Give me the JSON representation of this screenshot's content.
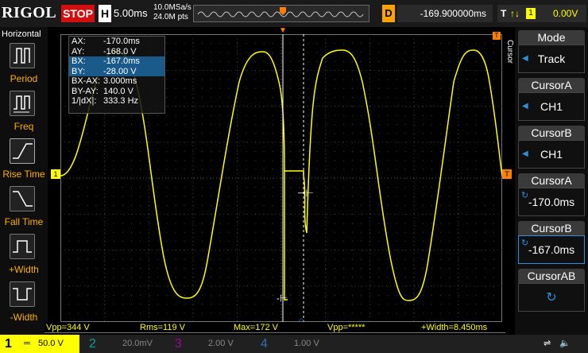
{
  "topbar": {
    "logo": "RIGOL",
    "run_state": "STOP",
    "h_label": "H",
    "timebase": "5.00ms",
    "sample_rate": "10.0MSa/s",
    "mem_depth": "24.0M pts",
    "delay_label": "D",
    "delay_value": "-169.900000ms",
    "trigger_label": "T",
    "trigger_source": "1",
    "trigger_level": "0.00V"
  },
  "left_panel": {
    "title": "Horizontal",
    "items": [
      {
        "label": "Period",
        "icon": "period-icon"
      },
      {
        "label": "Freq",
        "icon": "freq-icon"
      },
      {
        "label": "Rise Time",
        "icon": "rise-time-icon"
      },
      {
        "label": "Fall Time",
        "icon": "fall-time-icon"
      },
      {
        "label": "+Width",
        "icon": "pos-width-icon"
      },
      {
        "label": "-Width",
        "icon": "neg-width-icon"
      }
    ]
  },
  "cursor_readout": {
    "rows": [
      {
        "key": "AX:",
        "value": "-170.0ms"
      },
      {
        "key": "AY:",
        "value": "-168.0 V"
      },
      {
        "key": "BX:",
        "value": "-167.0ms"
      },
      {
        "key": "BY:",
        "value": "-28.00 V"
      },
      {
        "key": "BX-AX:",
        "value": "3.000ms"
      },
      {
        "key": "BY-AY:",
        "value": "140.0 V"
      },
      {
        "key": "1/|dX|:",
        "value": "333.3 Hz"
      }
    ]
  },
  "right_panel": {
    "side_tab": "Cursor",
    "items": [
      {
        "title": "Mode",
        "value": "Track"
      },
      {
        "title": "CursorA",
        "value": "CH1"
      },
      {
        "title": "CursorB",
        "value": "CH1"
      },
      {
        "title": "CursorA",
        "value": "-170.0ms"
      },
      {
        "title": "CursorB",
        "value": "-167.0ms"
      },
      {
        "title": "CursorAB",
        "value": ""
      }
    ]
  },
  "measurements": [
    "Vpp=344 V",
    "Rms=119 V",
    "Max=172 V",
    "Vpp=*****",
    "+Width=8.450ms"
  ],
  "channels": [
    {
      "num": "1",
      "scale": "50.0 V"
    },
    {
      "num": "2",
      "scale": "20.0mV"
    },
    {
      "num": "3",
      "scale": "2.00 V"
    },
    {
      "num": "4",
      "scale": "1.00 V"
    }
  ],
  "colors": {
    "ch1": "#ffff00",
    "ch2": "#00ffff",
    "ch3": "#ff00ff",
    "ch4": "#2f8fd8",
    "trigger": "#ff8000",
    "stop": "#d01010"
  }
}
